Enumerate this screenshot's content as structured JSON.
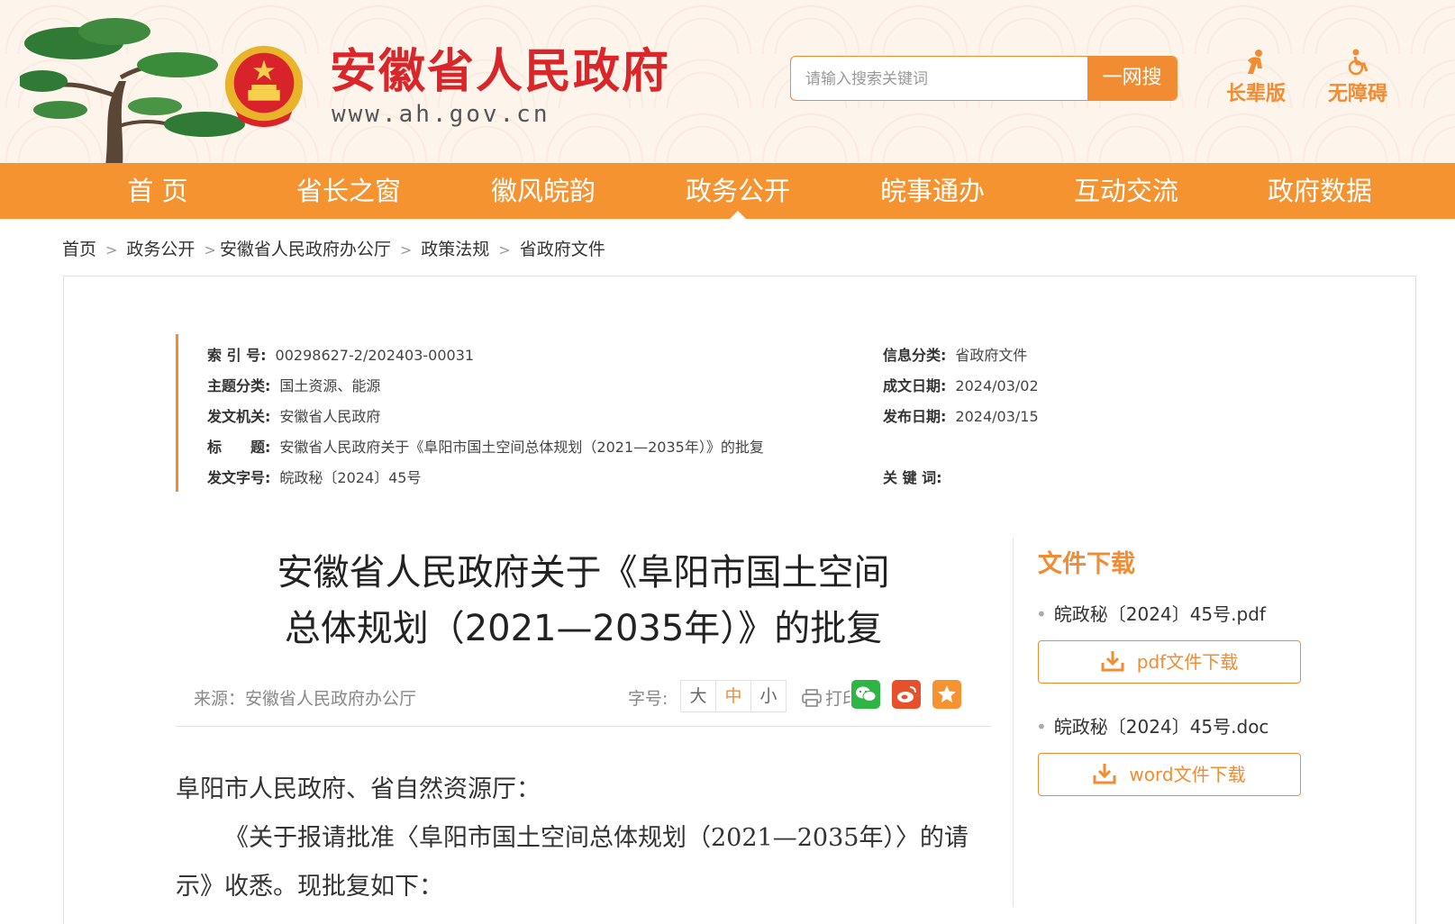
{
  "header": {
    "site_title": "安徽省人民政府",
    "site_url": "www.ah.gov.cn",
    "search_placeholder": "请输入搜索关键词",
    "search_button": "一网搜",
    "tools": [
      {
        "label": "长辈版",
        "icon": "elder-icon"
      },
      {
        "label": "无障碍",
        "icon": "wheelchair-icon"
      }
    ],
    "accent": "#f28c33",
    "title_color": "#d8262a"
  },
  "nav": {
    "items": [
      "首 页",
      "省长之窗",
      "徽风皖韵",
      "政务公开",
      "皖事通办",
      "互动交流",
      "政府数据"
    ],
    "active": "政务公开",
    "color": "#f59331"
  },
  "breadcrumb": [
    "首页",
    "政务公开",
    "安徽省人民政府办公厅",
    "政策法规",
    "省政府文件"
  ],
  "meta": {
    "index_no": {
      "key": "索 引 号:",
      "value": "00298627-2/202403-00031"
    },
    "info_category": {
      "key": "信息分类:",
      "value": "省政府文件"
    },
    "topic": {
      "key": "主题分类:",
      "value": "国土资源、能源"
    },
    "created": {
      "key": "成文日期:",
      "value": "2024/03/02"
    },
    "issuer": {
      "key": "发文机关:",
      "value": "安徽省人民政府"
    },
    "published": {
      "key": "发布日期:",
      "value": "2024/03/15"
    },
    "title": {
      "key": "标　　题:",
      "value": "安徽省人民政府关于《阜阳市国土空间总体规划（2021—2035年）》的批复"
    },
    "doc_no": {
      "key": "发文字号:",
      "value": "皖政秘〔2024〕45号"
    },
    "keywords": {
      "key": "关 键 词:",
      "value": ""
    }
  },
  "article": {
    "title_line1": "安徽省人民政府关于《阜阳市国土空间",
    "title_line2": "总体规划（2021—2035年）》的批复",
    "source": "来源：安徽省人民政府办公厅",
    "font_size_label": "字号:",
    "font_sizes": [
      "大",
      "中",
      "小"
    ],
    "font_size_selected": "中",
    "print": "打印",
    "share": [
      {
        "icon": "wechat-icon",
        "color": "#2fb544"
      },
      {
        "icon": "weibo-icon",
        "color": "#e6512c"
      },
      {
        "icon": "favorite-star-icon",
        "color": "#f59331"
      }
    ],
    "salutation": "阜阳市人民政府、省自然资源厅：",
    "para1_line1": "《关于报请批准〈阜阳市国土空间总体规划（2021—2035年）〉的请",
    "para1_line2": "示》收悉。现批复如下："
  },
  "downloads": {
    "heading": "文件下载",
    "files": [
      {
        "name": "皖政秘〔2024〕45号.pdf",
        "button": "pdf文件下载"
      },
      {
        "name": "皖政秘〔2024〕45号.doc",
        "button": "word文件下载"
      }
    ]
  }
}
